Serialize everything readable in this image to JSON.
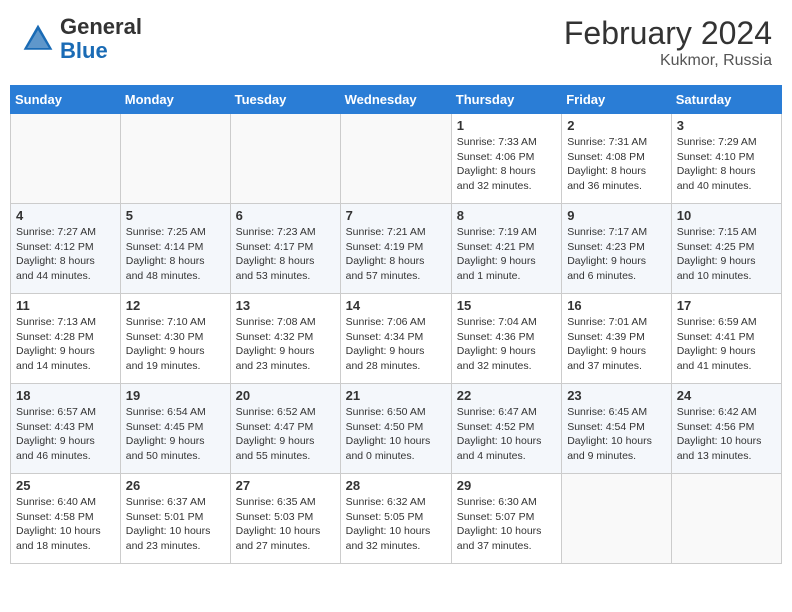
{
  "header": {
    "logo_general": "General",
    "logo_blue": "Blue",
    "month_year": "February 2024",
    "location": "Kukmor, Russia"
  },
  "days_of_week": [
    "Sunday",
    "Monday",
    "Tuesday",
    "Wednesday",
    "Thursday",
    "Friday",
    "Saturday"
  ],
  "weeks": [
    [
      {
        "day": "",
        "info": ""
      },
      {
        "day": "",
        "info": ""
      },
      {
        "day": "",
        "info": ""
      },
      {
        "day": "",
        "info": ""
      },
      {
        "day": "1",
        "info": "Sunrise: 7:33 AM\nSunset: 4:06 PM\nDaylight: 8 hours\nand 32 minutes."
      },
      {
        "day": "2",
        "info": "Sunrise: 7:31 AM\nSunset: 4:08 PM\nDaylight: 8 hours\nand 36 minutes."
      },
      {
        "day": "3",
        "info": "Sunrise: 7:29 AM\nSunset: 4:10 PM\nDaylight: 8 hours\nand 40 minutes."
      }
    ],
    [
      {
        "day": "4",
        "info": "Sunrise: 7:27 AM\nSunset: 4:12 PM\nDaylight: 8 hours\nand 44 minutes."
      },
      {
        "day": "5",
        "info": "Sunrise: 7:25 AM\nSunset: 4:14 PM\nDaylight: 8 hours\nand 48 minutes."
      },
      {
        "day": "6",
        "info": "Sunrise: 7:23 AM\nSunset: 4:17 PM\nDaylight: 8 hours\nand 53 minutes."
      },
      {
        "day": "7",
        "info": "Sunrise: 7:21 AM\nSunset: 4:19 PM\nDaylight: 8 hours\nand 57 minutes."
      },
      {
        "day": "8",
        "info": "Sunrise: 7:19 AM\nSunset: 4:21 PM\nDaylight: 9 hours\nand 1 minute."
      },
      {
        "day": "9",
        "info": "Sunrise: 7:17 AM\nSunset: 4:23 PM\nDaylight: 9 hours\nand 6 minutes."
      },
      {
        "day": "10",
        "info": "Sunrise: 7:15 AM\nSunset: 4:25 PM\nDaylight: 9 hours\nand 10 minutes."
      }
    ],
    [
      {
        "day": "11",
        "info": "Sunrise: 7:13 AM\nSunset: 4:28 PM\nDaylight: 9 hours\nand 14 minutes."
      },
      {
        "day": "12",
        "info": "Sunrise: 7:10 AM\nSunset: 4:30 PM\nDaylight: 9 hours\nand 19 minutes."
      },
      {
        "day": "13",
        "info": "Sunrise: 7:08 AM\nSunset: 4:32 PM\nDaylight: 9 hours\nand 23 minutes."
      },
      {
        "day": "14",
        "info": "Sunrise: 7:06 AM\nSunset: 4:34 PM\nDaylight: 9 hours\nand 28 minutes."
      },
      {
        "day": "15",
        "info": "Sunrise: 7:04 AM\nSunset: 4:36 PM\nDaylight: 9 hours\nand 32 minutes."
      },
      {
        "day": "16",
        "info": "Sunrise: 7:01 AM\nSunset: 4:39 PM\nDaylight: 9 hours\nand 37 minutes."
      },
      {
        "day": "17",
        "info": "Sunrise: 6:59 AM\nSunset: 4:41 PM\nDaylight: 9 hours\nand 41 minutes."
      }
    ],
    [
      {
        "day": "18",
        "info": "Sunrise: 6:57 AM\nSunset: 4:43 PM\nDaylight: 9 hours\nand 46 minutes."
      },
      {
        "day": "19",
        "info": "Sunrise: 6:54 AM\nSunset: 4:45 PM\nDaylight: 9 hours\nand 50 minutes."
      },
      {
        "day": "20",
        "info": "Sunrise: 6:52 AM\nSunset: 4:47 PM\nDaylight: 9 hours\nand 55 minutes."
      },
      {
        "day": "21",
        "info": "Sunrise: 6:50 AM\nSunset: 4:50 PM\nDaylight: 10 hours\nand 0 minutes."
      },
      {
        "day": "22",
        "info": "Sunrise: 6:47 AM\nSunset: 4:52 PM\nDaylight: 10 hours\nand 4 minutes."
      },
      {
        "day": "23",
        "info": "Sunrise: 6:45 AM\nSunset: 4:54 PM\nDaylight: 10 hours\nand 9 minutes."
      },
      {
        "day": "24",
        "info": "Sunrise: 6:42 AM\nSunset: 4:56 PM\nDaylight: 10 hours\nand 13 minutes."
      }
    ],
    [
      {
        "day": "25",
        "info": "Sunrise: 6:40 AM\nSunset: 4:58 PM\nDaylight: 10 hours\nand 18 minutes."
      },
      {
        "day": "26",
        "info": "Sunrise: 6:37 AM\nSunset: 5:01 PM\nDaylight: 10 hours\nand 23 minutes."
      },
      {
        "day": "27",
        "info": "Sunrise: 6:35 AM\nSunset: 5:03 PM\nDaylight: 10 hours\nand 27 minutes."
      },
      {
        "day": "28",
        "info": "Sunrise: 6:32 AM\nSunset: 5:05 PM\nDaylight: 10 hours\nand 32 minutes."
      },
      {
        "day": "29",
        "info": "Sunrise: 6:30 AM\nSunset: 5:07 PM\nDaylight: 10 hours\nand 37 minutes."
      },
      {
        "day": "",
        "info": ""
      },
      {
        "day": "",
        "info": ""
      }
    ]
  ]
}
